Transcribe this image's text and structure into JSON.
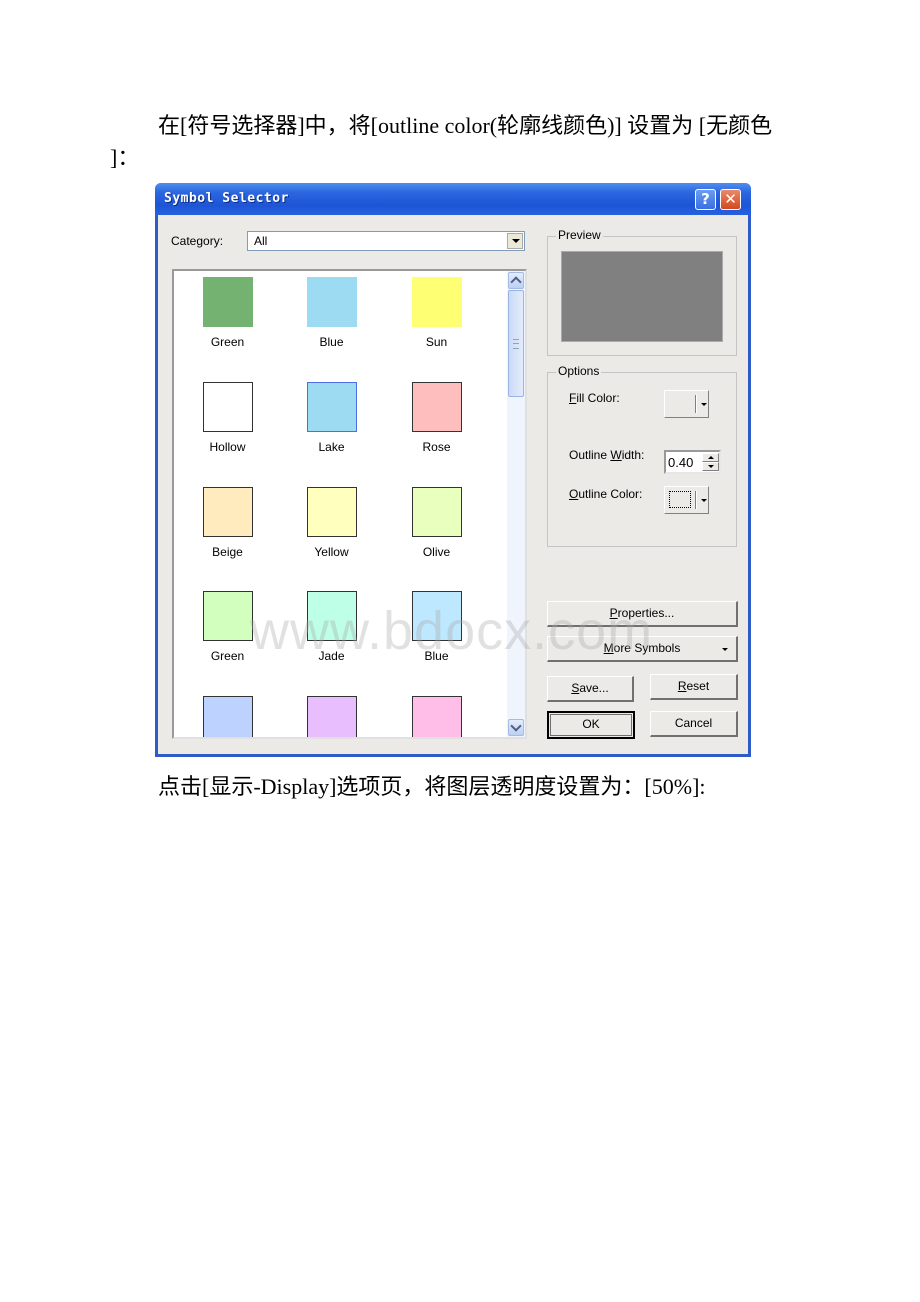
{
  "document": {
    "paragraph1_line1": "在[符号选择器]中，将[outline color(轮廓线颜色)] 设置为 [无颜色",
    "paragraph1_line2": "]：",
    "paragraph2": "点击[显示-Display]选项页，将图层透明度设置为：[50%]:",
    "watermark": "www.bdocx.com"
  },
  "dialog": {
    "title": "Symbol Selector",
    "help_icon": "help-icon",
    "close_icon": "close-icon",
    "help_glyph": "?",
    "close_glyph": "✕",
    "category_label": "Category:",
    "category_value": "All",
    "symbols": [
      {
        "label": "Green",
        "color": "#74b271",
        "outlined": false
      },
      {
        "label": "Blue",
        "color": "#9ddbf2",
        "outlined": false
      },
      {
        "label": "Sun",
        "color": "#ffff73",
        "outlined": false
      },
      {
        "label": "Hollow",
        "color": "#ffffff",
        "outlined": true
      },
      {
        "label": "Lake",
        "color": "#9ddbf2",
        "outlined": true,
        "outline_color": "#4d6fe6"
      },
      {
        "label": "Rose",
        "color": "#ffbebe",
        "outlined": true
      },
      {
        "label": "Beige",
        "color": "#ffebbe",
        "outlined": true
      },
      {
        "label": "Yellow",
        "color": "#ffffbe",
        "outlined": true
      },
      {
        "label": "Olive",
        "color": "#e9ffbe",
        "outlined": true
      },
      {
        "label": "Green",
        "color": "#d3ffbe",
        "outlined": true
      },
      {
        "label": "Jade",
        "color": "#beffe8",
        "outlined": true
      },
      {
        "label": "Blue",
        "color": "#bee8ff",
        "outlined": true
      },
      {
        "label": "",
        "color": "#bed2ff",
        "outlined": true
      },
      {
        "label": "",
        "color": "#e8beff",
        "outlined": true
      },
      {
        "label": "",
        "color": "#ffbee8",
        "outlined": true
      }
    ],
    "preview": {
      "label": "Preview",
      "fill_color": "#808080"
    },
    "options": {
      "label": "Options",
      "fill_color_label_prefix": "",
      "fill_color_label_u": "F",
      "fill_color_label_rest": "ill Color:",
      "outline_width_label_prefix": "Outline ",
      "outline_width_label_u": "W",
      "outline_width_label_rest": "idth:",
      "outline_width_value": "0.40",
      "outline_color_label_u": "O",
      "outline_color_label_rest": "utline Color:"
    },
    "buttons": {
      "properties_u": "P",
      "properties_rest": "roperties...",
      "more_symbols_u": "M",
      "more_symbols_rest": "ore Symbols",
      "save_u": "S",
      "save_rest": "ave...",
      "reset_u": "R",
      "reset_rest": "eset",
      "ok": "OK",
      "cancel": "Cancel"
    }
  }
}
